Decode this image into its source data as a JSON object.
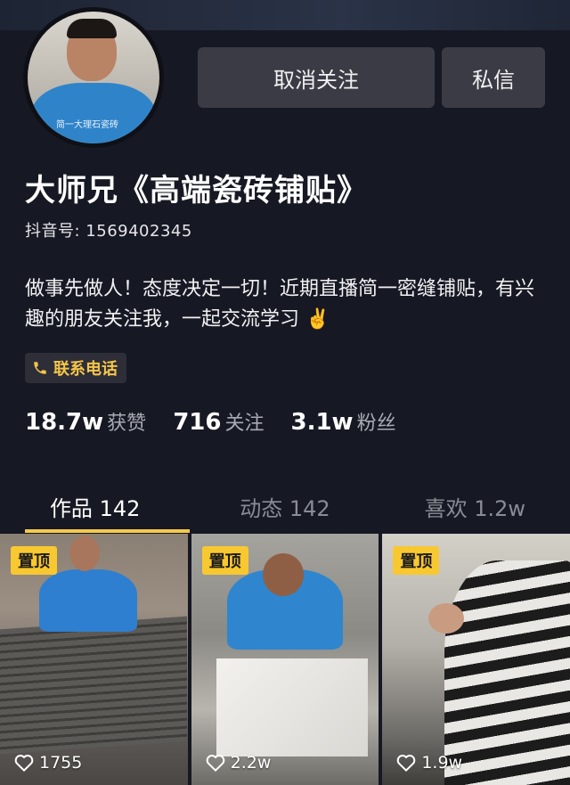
{
  "profile": {
    "name": "大师兄《高端瓷砖铺贴》",
    "douyin_id": "抖音号: 1569402345",
    "bio": "做事先做人！态度决定一切！近期直播简一密缝铺贴，有兴趣的朋友关注我，一起交流学习 ✌️",
    "contact_label": "联系电话",
    "avatar_shirt_print": "简一大理石瓷砖",
    "avatar_icon": "avatar-photo"
  },
  "actions": {
    "unfollow_label": "取消关注",
    "message_label": "私信"
  },
  "stats": [
    {
      "value": "18.7w",
      "label": "获赞"
    },
    {
      "value": "716",
      "label": "关注"
    },
    {
      "value": "3.1w",
      "label": "粉丝"
    }
  ],
  "tabs": [
    {
      "label": "作品 142",
      "active": true
    },
    {
      "label": "动态 142",
      "active": false
    },
    {
      "label": "喜欢 1.2w",
      "active": false
    }
  ],
  "videos": [
    {
      "pinned_label": "置顶",
      "likes": "1755"
    },
    {
      "pinned_label": "置顶",
      "likes": "2.2w"
    },
    {
      "pinned_label": "置顶",
      "likes": "1.9w"
    }
  ],
  "colors": {
    "background": "#161823",
    "accent": "#f7c94a",
    "contact_text": "#f5c54a",
    "button_bg": "#3a3b45"
  },
  "icons": [
    "phone-icon",
    "heart-icon"
  ]
}
